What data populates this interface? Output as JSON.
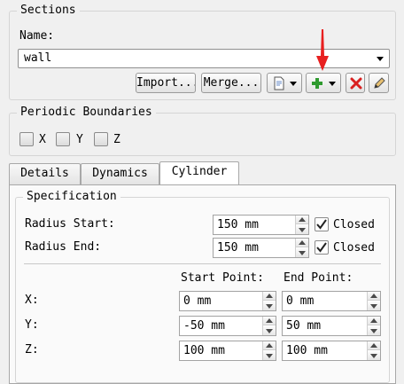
{
  "sections": {
    "title": "Sections",
    "name_label": "Name:",
    "name_value": "wall",
    "buttons": {
      "import": "Import...",
      "merge": "Merge..."
    }
  },
  "periodic": {
    "title": "Periodic Boundaries",
    "checkboxes": [
      {
        "label": "X",
        "checked": false
      },
      {
        "label": "Y",
        "checked": false
      },
      {
        "label": "Z",
        "checked": false
      }
    ]
  },
  "tabs": [
    {
      "label": "Details",
      "active": false
    },
    {
      "label": "Dynamics",
      "active": false
    },
    {
      "label": "Cylinder",
      "active": true
    }
  ],
  "specification": {
    "title": "Specification",
    "radius_start_label": "Radius Start:",
    "radius_start_value": "150 mm",
    "radius_start_closed": "Closed",
    "radius_end_label": "Radius End:",
    "radius_end_value": "150 mm",
    "radius_end_closed": "Closed",
    "start_point_header": "Start Point:",
    "end_point_header": "End Point:",
    "rows": [
      {
        "label": "X:",
        "start": "0 mm",
        "end": "0 mm"
      },
      {
        "label": "Y:",
        "start": "-50 mm",
        "end": "50 mm"
      },
      {
        "label": "Z:",
        "start": "100 mm",
        "end": "100 mm"
      }
    ]
  },
  "colors": {
    "add_icon": "#2f9a2f",
    "delete_icon": "#d92020",
    "red_arrow": "#e82020"
  },
  "icons": [
    "document-options-icon",
    "add-icon",
    "delete-icon",
    "edit-icon"
  ]
}
